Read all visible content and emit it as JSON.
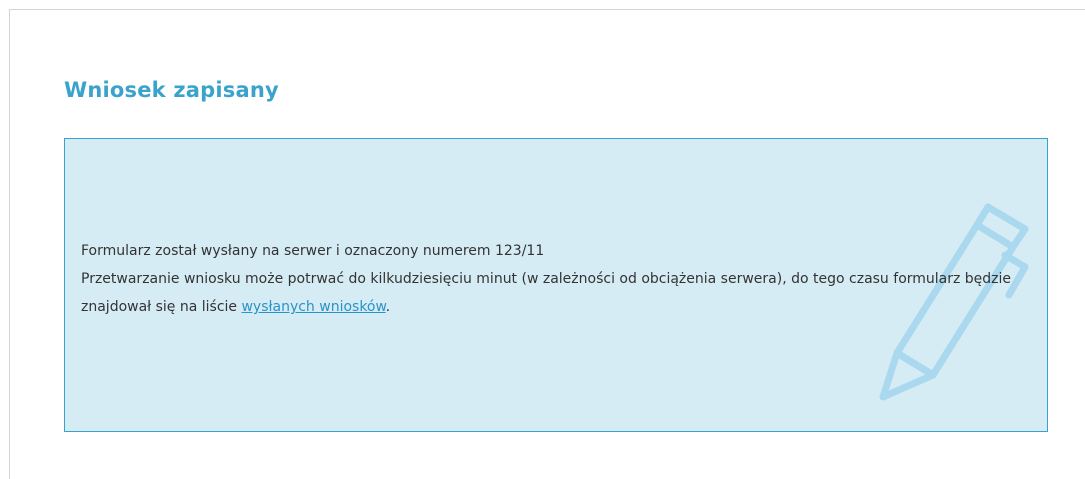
{
  "page": {
    "title": "Wniosek zapisany"
  },
  "message": {
    "line1": "Formularz został wysłany na serwer i oznaczony numerem 123/11",
    "line2_before": "Przetwarzanie wniosku może potrwać do kilkudziesięciu minut (w zależności od obciążenia serwera), do tego czasu formularz będzie znajdował się na liście ",
    "link_label": "wysłanych wniosków",
    "line2_after": "."
  },
  "icons": {
    "watermark": "pencil-icon"
  },
  "colors": {
    "accent": "#3aa3cc",
    "box_background": "#d6ecf4",
    "link": "#2a93c8",
    "text": "#333333"
  }
}
